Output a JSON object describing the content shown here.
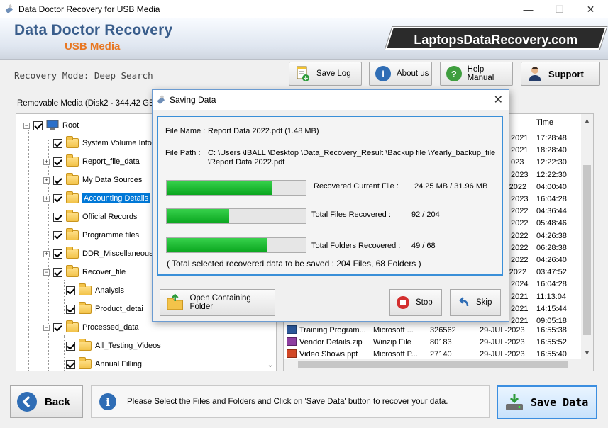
{
  "window": {
    "title": "Data Doctor Recovery for USB Media",
    "minimize": "—",
    "maximize": "☐",
    "close": "✕"
  },
  "header": {
    "brand_line1": "Data Doctor Recovery",
    "brand_line2": "USB Media",
    "website": "LaptopsDataRecovery.com"
  },
  "toolbar": {
    "mode": "Recovery Mode: Deep Search",
    "save_log": "Save Log",
    "about_us": "About us",
    "help_manual": "Help Manual",
    "support": "Support"
  },
  "media_label": "Removable Media (Disk2 - 344.42 GB) a",
  "tree": {
    "root": "Root",
    "items": [
      "System Volume Info",
      "Report_file_data",
      "My Data Sources",
      "Accounting Details",
      "Official Records",
      "Programme files",
      "DDR_Miscellaneous",
      "Recover_file",
      "Analysis",
      "Product_detai",
      "Processed_data",
      "All_Testing_Videos",
      "Annual Filling"
    ]
  },
  "list": {
    "time_header": "Time",
    "partial_rows": [
      [
        "2021",
        "17:28:48"
      ],
      [
        "2021",
        "18:28:40"
      ],
      [
        "023",
        "12:22:30"
      ],
      [
        "2023",
        "12:22:30"
      ],
      [
        "-2022",
        "04:00:40"
      ],
      [
        "2023",
        "16:04:28"
      ],
      [
        "2022",
        "04:36:44"
      ],
      [
        "2022",
        "05:48:46"
      ],
      [
        "2022",
        "04:26:38"
      ],
      [
        "2022",
        "06:28:38"
      ],
      [
        "2022",
        "04:26:40"
      ],
      [
        "-2022",
        "03:47:52"
      ],
      [
        "2024",
        "16:04:28"
      ],
      [
        "2021",
        "11:13:04"
      ],
      [
        "2021",
        "14:15:44"
      ],
      [
        "2021",
        "09:05:18"
      ]
    ],
    "rows": [
      {
        "name": "Training Program...",
        "type": "Microsoft ...",
        "size": "326562",
        "date": "29-JUL-2023",
        "time": "16:55:38"
      },
      {
        "name": "Vendor Details.zip",
        "type": "Winzip File",
        "size": "80183",
        "date": "29-JUL-2023",
        "time": "16:55:52"
      },
      {
        "name": "Video Shows.ppt",
        "type": "Microsoft P...",
        "size": "27140",
        "date": "29-JUL-2023",
        "time": "16:55:40"
      }
    ]
  },
  "dialog": {
    "title": "Saving Data",
    "close": "✕",
    "file_name_label": "File Name :",
    "file_name": "Report Data 2022.pdf (1.48 MB)",
    "file_path_label": "File Path :",
    "file_path_line1": "C: \\Users \\IBALL \\Desktop \\Data_Recovery_Result \\Backup file \\Yearly_backup_file",
    "file_path_line2": "\\Report Data 2022.pdf",
    "progress": [
      {
        "label": "Recovered Current File :",
        "value": "24.25 MB / 31.96 MB",
        "fraction": 0.76
      },
      {
        "label": "Total Files Recovered :",
        "value": "92 / 204",
        "fraction": 0.45
      },
      {
        "label": "Total Folders Recovered :",
        "value": "49 / 68",
        "fraction": 0.72
      }
    ],
    "summary": "( Total selected recovered data to be saved : 204 Files, 68 Folders )",
    "open_folder": "Open Containing Folder",
    "stop": "Stop",
    "skip": "Skip"
  },
  "bottom": {
    "back": "Back",
    "info": "Please Select the Files and Folders and Click on 'Save Data' button to recover your data.",
    "save_data": "Save Data"
  }
}
